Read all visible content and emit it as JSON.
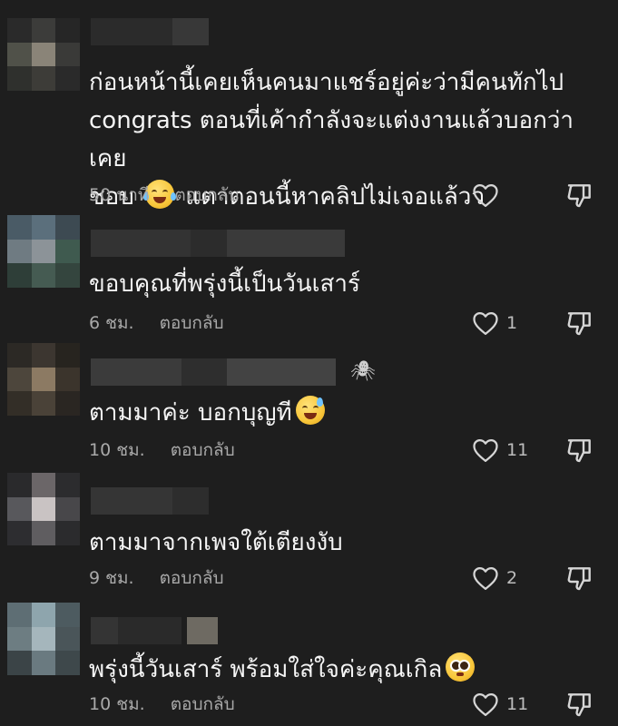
{
  "comments": [
    {
      "text_lines": [
        "ก่อนหน้านี้เคยเห็นคนมาแชร์อยู่ค่ะว่ามีคนทักไป",
        "congrats ตอนที่เค้ากำลังจะแต่งงานแล้วบอกว่าเคย"
      ],
      "text_last_before": "ชอบ ",
      "emoji": "face-with-tears-of-joy",
      "text_last_after": " แตาตอนนี้หาคลิปไม่เจอแล้วว",
      "time": "50 นาที",
      "reply_label": "ตอบกลับ",
      "likes": "",
      "avatar_colors": [
        "#2a2a2a",
        "#3c3c3a",
        "#262626",
        "#505149",
        "#8a8478",
        "#3a3a38",
        "#2f302d",
        "#3d3c38",
        "#2a2a2a"
      ],
      "username_blocks": [
        "#2b2b2b",
        "#383838"
      ]
    },
    {
      "text_lines": [
        "ขอบคุณที่พรุ่งนี้เป็นวันเสาร์"
      ],
      "time": "6 ชม.",
      "reply_label": "ตอบกลับ",
      "likes": "1",
      "avatar_colors": [
        "#4a5b66",
        "#5b6f7c",
        "#3d4a52",
        "#6f7b82",
        "#8c9398",
        "#3f5a4f",
        "#2e3e38",
        "#455b52",
        "#34453e"
      ],
      "username_blocks": [
        "#333333",
        "#2c2c2c",
        "#3a3a3a"
      ]
    },
    {
      "text_lines": [
        "ตามมาค่ะ บอกบุญที"
      ],
      "emoji_end": "grinning-face-with-sweat",
      "time": "10 ชม.",
      "reply_label": "ตอบกลับ",
      "likes": "11",
      "avatar_colors": [
        "#2c2925",
        "#3c3630",
        "#27241f",
        "#4d463c",
        "#8c7a63",
        "#3b342c",
        "#332e27",
        "#4a4238",
        "#2a2622"
      ],
      "username_blocks": [
        "#3b3b3b",
        "#2e2e2e",
        "#434343"
      ],
      "username_deco": "🕷"
    },
    {
      "text_lines": [
        "ตามมาจากเพจใต้เตียงงับ"
      ],
      "time": "9 ชม.",
      "reply_label": "ตอบกลับ",
      "likes": "2",
      "avatar_colors": [
        "#2a2a2c",
        "#6b6668",
        "#2c2c2e",
        "#58585c",
        "#c9c3c3",
        "#48474a",
        "#2d2d30",
        "#5f5d60",
        "#2b2b2d"
      ],
      "username_blocks": [
        "#353535",
        "#2d2d2d"
      ]
    },
    {
      "text_lines": [
        "พรุ่งนี้วันเสาร์ พร้อมใส่ใจค่ะคุณเกิล"
      ],
      "emoji_end": "flushed-face",
      "time": "10 ชม.",
      "reply_label": "ตอบกลับ",
      "likes": "11",
      "avatar_colors": [
        "#5e6e74",
        "#8ea5ad",
        "#4d5b60",
        "#6d7d82",
        "#a5b6bc",
        "#4a5559",
        "#3b4447",
        "#6a7a80",
        "#3e484b"
      ],
      "username_blocks": [
        "#343434",
        "#2a2a2a",
        "#6e6a62"
      ]
    }
  ]
}
